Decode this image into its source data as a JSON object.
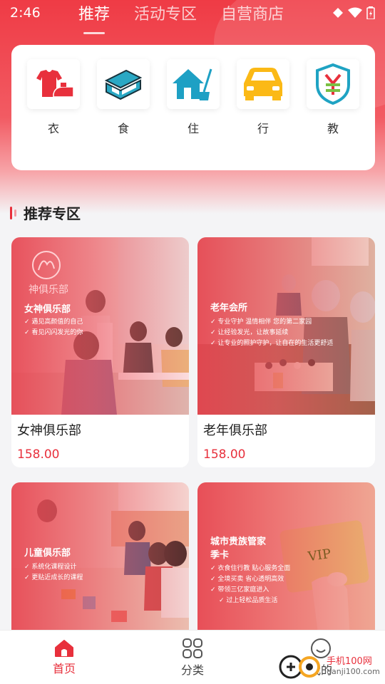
{
  "status_bar": {
    "time": "2:46"
  },
  "top_tabs": [
    {
      "label": "推荐",
      "active": true
    },
    {
      "label": "活动专区",
      "active": false
    },
    {
      "label": "自营商店",
      "active": false
    }
  ],
  "categories": [
    {
      "label": "衣",
      "icon": "clothing-icon"
    },
    {
      "label": "食",
      "icon": "food-box-icon"
    },
    {
      "label": "住",
      "icon": "house-icon"
    },
    {
      "label": "行",
      "icon": "car-icon"
    },
    {
      "label": "教",
      "icon": "education-shield-icon"
    }
  ],
  "section": {
    "title": "推荐专区"
  },
  "products": [
    {
      "name": "女神俱乐部",
      "price": "158.00",
      "img_logo": "神俱乐部",
      "img_title": "女神俱乐部",
      "img_bullets": [
        "遇见高颜值的自己",
        "看见闪闪发光的你"
      ]
    },
    {
      "name": "老年俱乐部",
      "price": "158.00",
      "img_title": "老年会所",
      "img_bullets": [
        "专业守护 温情相伴 您的第二家园",
        "让经验发光，让故事延续",
        "让专业的照护守护，让自在的生活更舒适"
      ]
    },
    {
      "name": "",
      "price": "",
      "img_title": "儿童俱乐部",
      "img_bullets": [
        "系统化课程设计",
        "更贴近成长的课程"
      ]
    },
    {
      "name": "",
      "price": "",
      "img_title": "城市贵族管家季卡",
      "img_title_lines": [
        "城市贵族管家",
        "季卡"
      ],
      "img_bullets": [
        "衣食住行教 贴心服务全面",
        "全境买卖 省心透明高效",
        "带领三亿家庭进入",
        "过上轻松品质生活"
      ],
      "vip_text": "VIP"
    }
  ],
  "bottom_nav": [
    {
      "label": "首页",
      "icon": "home-icon",
      "active": true
    },
    {
      "label": "分类",
      "icon": "grid-icon",
      "active": false
    },
    {
      "label": "我的",
      "icon": "smiley-icon",
      "active": false
    }
  ],
  "watermark": {
    "text": "手机100网",
    "sub": "danji100.com"
  },
  "colors": {
    "brand_red": "#e8303c",
    "header_red": "#ef3b45"
  }
}
